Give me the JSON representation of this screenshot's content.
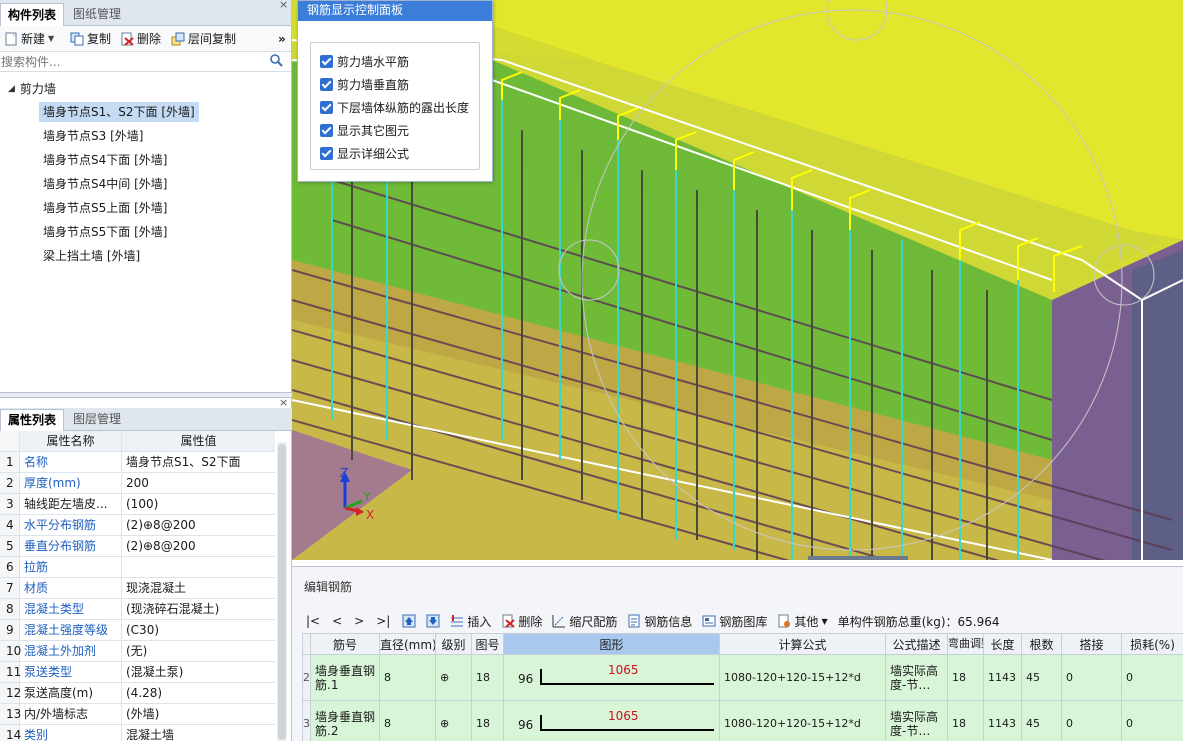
{
  "left_top": {
    "tabs": [
      "构件列表",
      "图纸管理"
    ],
    "toolbar": {
      "new": "新建",
      "copy": "复制",
      "delete": "删除",
      "floor_copy": "层间复制",
      "more": "»"
    },
    "search_placeholder": "搜索构件...",
    "tree": {
      "root": "剪力墙",
      "items": [
        "墙身节点S1、S2下面 [外墙]",
        "墙身节点S3 [外墙]",
        "墙身节点S4下面 [外墙]",
        "墙身节点S4中间 [外墙]",
        "墙身节点S5上面 [外墙]",
        "墙身节点S5下面 [外墙]",
        "梁上挡土墙 [外墙]"
      ]
    }
  },
  "left_bottom": {
    "tabs": [
      "属性列表",
      "图层管理"
    ],
    "header": {
      "name": "属性名称",
      "value": "属性值"
    },
    "rows": [
      {
        "n": "1",
        "name": "名称",
        "value": "墙身节点S1、S2下面",
        "blue": true
      },
      {
        "n": "2",
        "name": "厚度(mm)",
        "value": "200",
        "blue": true
      },
      {
        "n": "3",
        "name": "轴线距左墙皮...",
        "value": "(100)",
        "blue": false
      },
      {
        "n": "4",
        "name": "水平分布钢筋",
        "value": "(2)⊕8@200",
        "blue": true
      },
      {
        "n": "5",
        "name": "垂直分布钢筋",
        "value": "(2)⊕8@200",
        "blue": true
      },
      {
        "n": "6",
        "name": "拉筋",
        "value": "",
        "blue": true
      },
      {
        "n": "7",
        "name": "材质",
        "value": "现浇混凝土",
        "blue": true
      },
      {
        "n": "8",
        "name": "混凝土类型",
        "value": "(现浇碎石混凝土)",
        "blue": true
      },
      {
        "n": "9",
        "name": "混凝土强度等级",
        "value": "(C30)",
        "blue": true
      },
      {
        "n": "10",
        "name": "混凝土外加剂",
        "value": "(无)",
        "blue": true
      },
      {
        "n": "11",
        "name": "泵送类型",
        "value": "(混凝土泵)",
        "blue": true
      },
      {
        "n": "12",
        "name": "泵送高度(m)",
        "value": "(4.28)",
        "blue": false
      },
      {
        "n": "13",
        "name": "内/外墙标志",
        "value": "(外墙)",
        "blue": false
      },
      {
        "n": "14",
        "name": "类别",
        "value": "混凝土墙",
        "blue": true
      }
    ]
  },
  "control_panel": {
    "title": "钢筋显示控制面板",
    "options": [
      {
        "label": "剪力墙水平筋",
        "checked": true
      },
      {
        "label": "剪力墙垂直筋",
        "checked": true
      },
      {
        "label": "下层墙体纵筋的露出长度",
        "checked": true
      },
      {
        "label": "显示其它图元",
        "checked": true
      },
      {
        "label": "显示详细公式",
        "checked": true
      }
    ]
  },
  "axes": {
    "z": "Z",
    "y": "Y",
    "x": "X"
  },
  "editor": {
    "title": "编辑钢筋",
    "nav": [
      "|<",
      "<",
      ">",
      ">|"
    ],
    "toolbar": {
      "insert": "插入",
      "delete": "删除",
      "scale": "缩尺配筋",
      "info": "钢筋信息",
      "library": "钢筋图库",
      "other": "其他",
      "total": "单构件钢筋总重(kg)：65.964"
    },
    "columns": [
      "筋号",
      "直径(mm)",
      "级别",
      "图号",
      "图形",
      "计算公式",
      "公式描述",
      "弯曲调整",
      "长度",
      "根数",
      "搭接",
      "损耗(%)"
    ],
    "rows": [
      {
        "n": "2",
        "name": "墙身垂直钢筋.1",
        "diameter": "8",
        "grade": "⊕",
        "fig_no": "18",
        "shape_left": "96",
        "shape_len": "1065",
        "formula": "1080-120+120-15+12*d",
        "desc": "墙实际高度-节…",
        "bend": "18",
        "length": "1143",
        "count": "45",
        "lap": "0",
        "loss": "0"
      },
      {
        "n": "3",
        "name": "墙身垂直钢筋.2",
        "diameter": "8",
        "grade": "⊕",
        "fig_no": "18",
        "shape_left": "96",
        "shape_len": "1065",
        "formula": "1080-120+120-15+12*d",
        "desc": "墙实际高度-节…",
        "bend": "18",
        "length": "1143",
        "count": "45",
        "lap": "0",
        "loss": "0"
      }
    ]
  }
}
